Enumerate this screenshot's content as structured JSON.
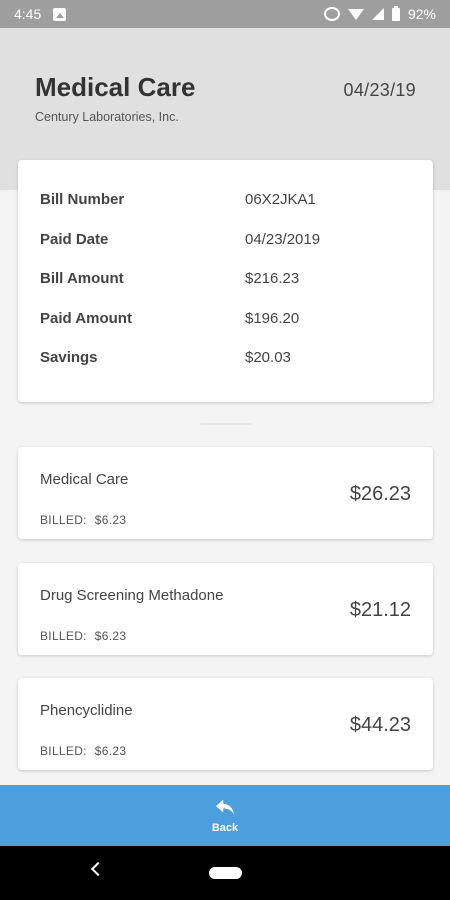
{
  "status_bar": {
    "time": "4:45",
    "battery": "92%"
  },
  "header": {
    "title": "Medical Care",
    "subtitle": "Century Laboratories, Inc.",
    "date": "04/23/19"
  },
  "summary": {
    "rows": [
      {
        "label": "Bill Number",
        "value": "06X2JKA1"
      },
      {
        "label": "Paid Date",
        "value": "04/23/2019"
      },
      {
        "label": "Bill Amount",
        "value": "$216.23"
      },
      {
        "label": "Paid Amount",
        "value": "$196.20"
      },
      {
        "label": "Savings",
        "value": "$20.03"
      }
    ]
  },
  "line_items": [
    {
      "name": "Medical Care",
      "billed_label": "BILLED:",
      "billed_value": "$6.23",
      "amount": "$26.23"
    },
    {
      "name": "Drug Screening Methadone",
      "billed_label": "BILLED:",
      "billed_value": "$6.23",
      "amount": "$21.12"
    },
    {
      "name": "Phencyclidine",
      "billed_label": "BILLED:",
      "billed_value": "$6.23",
      "amount": "$44.23"
    }
  ],
  "bottom_bar": {
    "back_label": "Back",
    "icon": "reply-icon"
  },
  "colors": {
    "header_bg": "#e0e0e0",
    "accent": "#4a9fdc",
    "status_bar": "#9e9e9e"
  }
}
